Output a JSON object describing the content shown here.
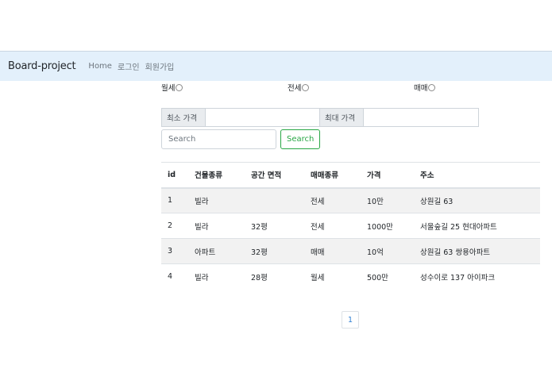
{
  "navbar": {
    "brand": "Board-project",
    "links": [
      "Home",
      "로그인",
      "회원가입"
    ]
  },
  "filters": {
    "radios": [
      "월세",
      "전세",
      "매매"
    ],
    "min_price_label": "최소 가격",
    "max_price_label": "최대 가격",
    "search_placeholder": "Search",
    "search_button": "Search"
  },
  "table": {
    "headers": [
      "id",
      "건물종류",
      "공간 면적",
      "매매종류",
      "가격",
      "주소"
    ],
    "rows": [
      [
        "1",
        "빌라",
        "",
        "전세",
        "10만",
        "상원길 63"
      ],
      [
        "2",
        "빌라",
        "32평",
        "전세",
        "1000만",
        "서울숲길 25 현대아파트"
      ],
      [
        "3",
        "아파트",
        "32평",
        "매매",
        "10억",
        "상원길 63 쌍용아파트"
      ],
      [
        "4",
        "빌라",
        "28평",
        "월세",
        "500만",
        "성수이로 137 아이파크"
      ]
    ]
  },
  "pagination": {
    "current": "1"
  }
}
